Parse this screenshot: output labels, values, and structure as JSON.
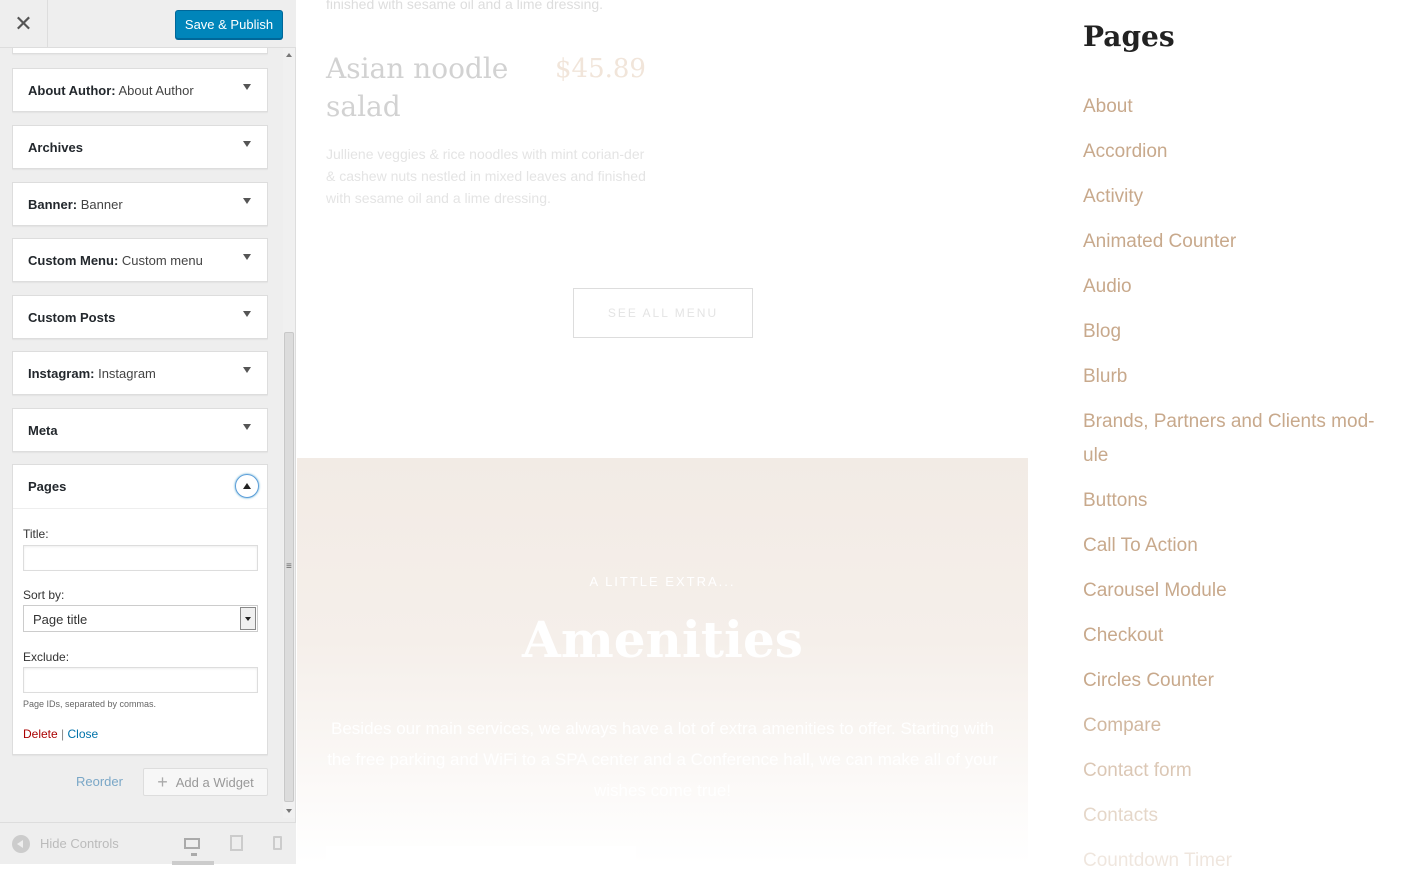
{
  "panel": {
    "close_glyph": "✕",
    "save_label": "Save & Publish",
    "widgets": [
      {
        "title": "About Author:",
        "sub": " About Author"
      },
      {
        "title": "Archives",
        "sub": ""
      },
      {
        "title": "Banner:",
        "sub": " Banner"
      },
      {
        "title": "Custom Menu:",
        "sub": " Custom menu"
      },
      {
        "title": "Custom Posts",
        "sub": ""
      },
      {
        "title": "Instagram:",
        "sub": " Instagram"
      },
      {
        "title": "Meta",
        "sub": ""
      }
    ],
    "pages_widget": {
      "title": "Pages",
      "title_label": "Title:",
      "title_value": "",
      "sort_label": "Sort by:",
      "sort_value": "Page title",
      "exclude_label": "Exclude:",
      "exclude_value": "",
      "exclude_help": "Page IDs, separated by commas.",
      "delete_label": "Delete",
      "separator": "|",
      "close_label": "Close"
    },
    "reorder_label": "Reorder",
    "add_widget_label": "Add a Widget",
    "hide_controls_label": "Hide Controls"
  },
  "preview": {
    "top_line": "finished with sesame oil and a lime dressing.",
    "dish": {
      "name": "Asian noodle salad",
      "price": "$45.89",
      "description": "Julliene veggies & rice noodles with mint corian-der & cashew nuts nestled in mixed leaves and finished with sesame oil and a lime dressing."
    },
    "see_all_label": "SEE ALL MENU",
    "amenities": {
      "kicker": "A LITTLE EXTRA...",
      "title": "Amenities",
      "text": "Besides our main services, we always have a lot of extra amenities to offer. Starting with the free parking and WiFi to a SPA center and a Conference hall, we can make all of your wishes come true!"
    }
  },
  "sidebar": {
    "title": "Pages",
    "pages": [
      "About",
      "Accordion",
      "Activity",
      "Animated Counter",
      "Audio",
      "Blog",
      "Blurb",
      "Brands, Partners and Clients mod-ule",
      "Buttons",
      "Call To Action",
      "Carousel Module",
      "Checkout",
      "Circles Counter",
      "Compare",
      "Contact form",
      "Contacts",
      "Countdown Timer"
    ]
  },
  "colors": {
    "accent": "#0085ba",
    "link_beige": "#c8a98c",
    "delete_red": "#aa0000"
  }
}
